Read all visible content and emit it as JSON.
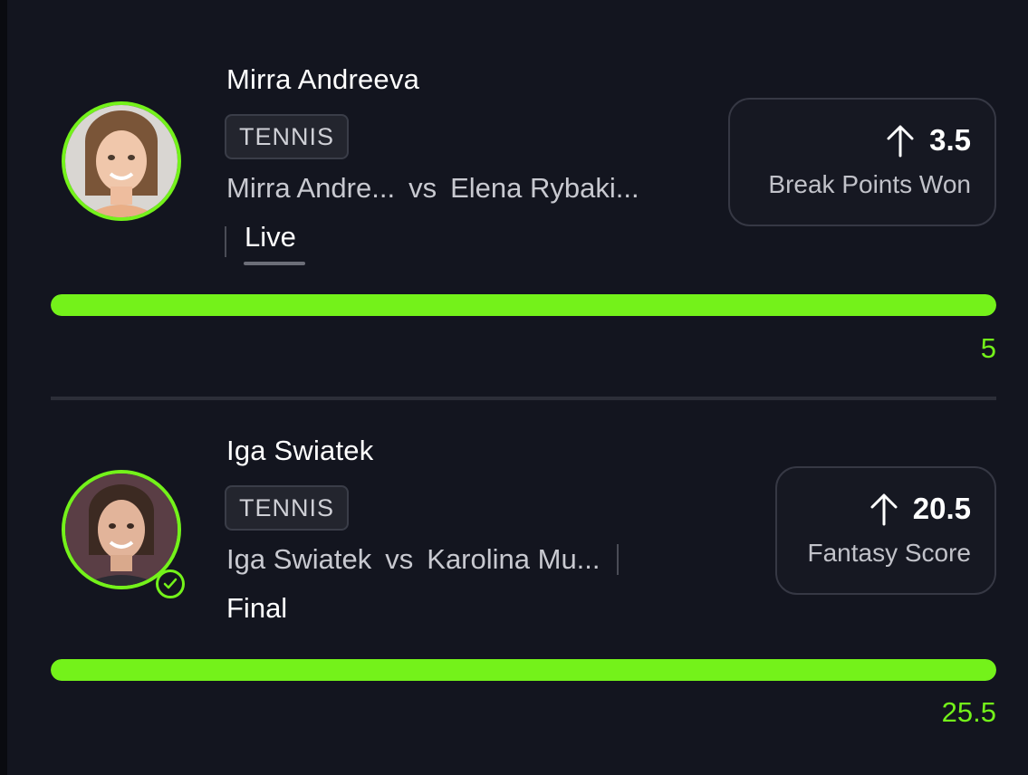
{
  "colors": {
    "background": "#13151f",
    "accent": "#74f21a",
    "badge_bg": "#23252e",
    "text_secondary": "#c8c9d0"
  },
  "picks": [
    {
      "player_name": "Mirra Andreeva",
      "sport": "TENNIS",
      "home": "Mirra Andre...",
      "vs": "vs",
      "away": "Elena Rybaki...",
      "status": "Live",
      "direction_icon": "arrow-up-icon",
      "line": "3.5",
      "stat": "Break Points Won",
      "current_value": "5",
      "progress": 1.0,
      "completed": false
    },
    {
      "player_name": "Iga Swiatek",
      "sport": "TENNIS",
      "home": "Iga Swiatek",
      "vs": "vs",
      "away": "Karolina Mu...",
      "status": "Final",
      "direction_icon": "arrow-up-icon",
      "line": "20.5",
      "stat": "Fantasy Score",
      "current_value": "25.5",
      "progress": 1.0,
      "completed": true
    }
  ]
}
